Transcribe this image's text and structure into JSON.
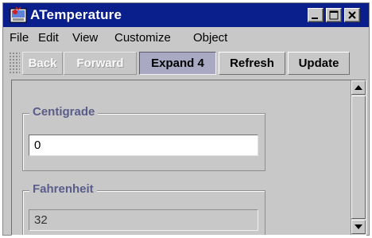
{
  "window": {
    "title": "ATemperature"
  },
  "menu": [
    "File",
    "Edit",
    "View",
    "Customize",
    "Object"
  ],
  "toolbar": {
    "back": "Back",
    "forward": "Forward",
    "expand": "Expand 4",
    "refresh": "Refresh",
    "update": "Update"
  },
  "centigrade": {
    "label": "Centigrade",
    "value": "0"
  },
  "fahrenheit": {
    "label": "Fahrenheit",
    "value": "32"
  },
  "colors": {
    "titlebar": "#0a1e8c",
    "group_label": "#5a5c8a",
    "window_bg": "#c8c8c8"
  },
  "icons": [
    "app-icon",
    "minimize-icon",
    "maximize-icon",
    "close-icon",
    "scroll-up-icon",
    "scroll-down-icon"
  ]
}
